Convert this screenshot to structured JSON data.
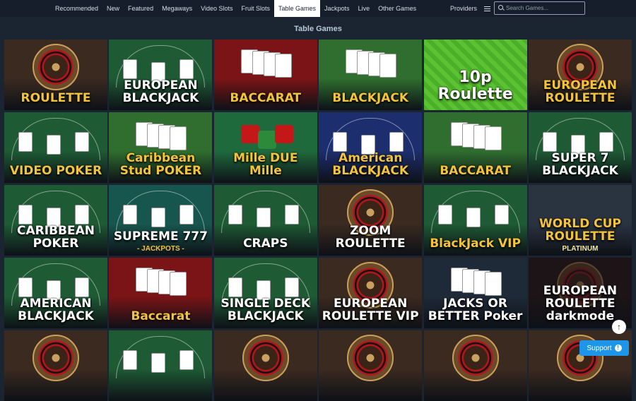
{
  "nav": {
    "items": [
      {
        "label": "Recommended",
        "active": false
      },
      {
        "label": "New",
        "active": false
      },
      {
        "label": "Featured",
        "active": false
      },
      {
        "label": "Megaways",
        "active": false
      },
      {
        "label": "Video Slots",
        "active": false
      },
      {
        "label": "Fruit Slots",
        "active": false
      },
      {
        "label": "Table Games",
        "active": true
      },
      {
        "label": "Jackpots",
        "active": false
      },
      {
        "label": "Live",
        "active": false
      },
      {
        "label": "Other Games",
        "active": false
      }
    ],
    "providers_label": "Providers",
    "search_placeholder": "Search Games..."
  },
  "section": {
    "title": "Table Games"
  },
  "games": [
    {
      "label": "ROULETTE",
      "sub": "",
      "theme": "roulette",
      "gold": true
    },
    {
      "label": "EUROPEAN BLACKJACK",
      "sub": "",
      "theme": "felt",
      "gold": false
    },
    {
      "label": "BACCARAT",
      "sub": "",
      "theme": "red",
      "gold": true
    },
    {
      "label": "BLACKJACK",
      "sub": "",
      "theme": "cards",
      "gold": true
    },
    {
      "label": "10p Roulette",
      "sub": "",
      "theme": "lime",
      "gold": false
    },
    {
      "label": "EUROPEAN ROULETTE",
      "sub": "",
      "theme": "roulette",
      "gold": true
    },
    {
      "label": "VIDEO POKER",
      "sub": "",
      "theme": "felt",
      "gold": true
    },
    {
      "label": "Caribbean Stud POKER",
      "sub": "",
      "theme": "cards",
      "gold": true
    },
    {
      "label": "Mille DUE Mille",
      "sub": "",
      "theme": "dice",
      "gold": true
    },
    {
      "label": "American BLACKJACK",
      "sub": "",
      "theme": "blue",
      "gold": true
    },
    {
      "label": "BACCARAT",
      "sub": "",
      "theme": "cards",
      "gold": true
    },
    {
      "label": "SUPER 7 BLACKJACK",
      "sub": "",
      "theme": "felt",
      "gold": false
    },
    {
      "label": "CARIBBEAN POKER",
      "sub": "",
      "theme": "felt",
      "gold": false
    },
    {
      "label": "SUPREME 777",
      "sub": "- JACKPOTS -",
      "theme": "teal",
      "gold": false
    },
    {
      "label": "CRAPS",
      "sub": "",
      "theme": "felt",
      "gold": false
    },
    {
      "label": "ZOOM ROULETTE",
      "sub": "",
      "theme": "roulette",
      "gold": false
    },
    {
      "label": "BlackJack VIP",
      "sub": "",
      "theme": "felt",
      "gold": true
    },
    {
      "label": "WORLD CUP ROULETTE",
      "sub": "PLATINUM",
      "theme": "silver",
      "gold": true
    },
    {
      "label": "AMERICAN BLACKJACK",
      "sub": "",
      "theme": "felt",
      "gold": false
    },
    {
      "label": "Baccarat",
      "sub": "",
      "theme": "red",
      "gold": true
    },
    {
      "label": "SINGLE DECK BLACKJACK",
      "sub": "",
      "theme": "felt",
      "gold": false
    },
    {
      "label": "EUROPEAN ROULETTE VIP",
      "sub": "",
      "theme": "roulette",
      "gold": false
    },
    {
      "label": "JACKS OR BETTER Poker",
      "sub": "",
      "theme": "dark",
      "gold": false
    },
    {
      "label": "EUROPEAN ROULETTE darkmode",
      "sub": "",
      "theme": "darkred",
      "gold": false
    },
    {
      "label": "",
      "sub": "",
      "theme": "roulette",
      "gold": false
    },
    {
      "label": "",
      "sub": "",
      "theme": "felt",
      "gold": false
    },
    {
      "label": "",
      "sub": "",
      "theme": "roulette",
      "gold": false
    },
    {
      "label": "",
      "sub": "",
      "theme": "roulette",
      "gold": false
    },
    {
      "label": "",
      "sub": "",
      "theme": "roulette",
      "gold": false
    },
    {
      "label": "",
      "sub": "",
      "theme": "roulette",
      "gold": false
    }
  ],
  "themes": {
    "roulette": "#3b2a20",
    "felt": "#1e5a34",
    "red": "#7a1416",
    "cards": "#2f6e2f",
    "lime": "#4caf2a",
    "dice": "#1f6a3c",
    "blue": "#1d2e6e",
    "teal": "#17564e",
    "silver": "#2a3340",
    "dark": "#1e2a38",
    "darkred": "#1c1416"
  },
  "support": {
    "label": "Support",
    "icon": "!"
  },
  "back_to_top": {
    "icon": "↑"
  }
}
